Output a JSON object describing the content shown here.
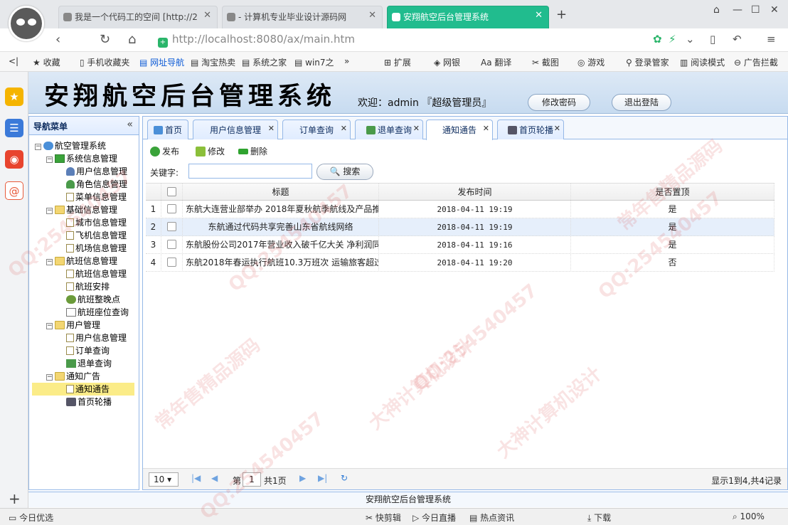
{
  "browser": {
    "tabs": [
      {
        "label": "我是一个代码工的空间 [http://2"
      },
      {
        "label": "- 计算机专业毕业设计源码网"
      },
      {
        "label": "安翔航空后台管理系统"
      }
    ],
    "new_tab": "+",
    "url_host": "http://localhost",
    "url_rest": ":8080/ax/main.htm",
    "bookmarks": [
      "收藏",
      "手机收藏夹",
      "网址导航",
      "淘宝热卖",
      "系统之家",
      "win7之",
      "扩展",
      "网银",
      "翻译",
      "截图",
      "游戏",
      "登录管家",
      "阅读模式",
      "广告拦截"
    ],
    "status": [
      "今日优选",
      "快剪辑",
      "今日直播",
      "热点资讯",
      "下载",
      "100%"
    ]
  },
  "app": {
    "title": "安翔航空后台管理系统",
    "welcome": "欢迎：admin 『超级管理员』",
    "change_password": "修改密码",
    "logout": "退出登陆",
    "footer": "安翔航空后台管理系统"
  },
  "nav": {
    "header": "导航菜单",
    "collapse": "«",
    "nodes": [
      {
        "label": "航空管理系统"
      },
      {
        "label": "系统信息管理"
      },
      {
        "label": "用户信息管理"
      },
      {
        "label": "角色信息管理"
      },
      {
        "label": "菜单信息管理"
      },
      {
        "label": "基础信息管理"
      },
      {
        "label": "城市信息管理"
      },
      {
        "label": "飞机信息管理"
      },
      {
        "label": "机场信息管理"
      },
      {
        "label": "航班信息管理"
      },
      {
        "label": "航班信息管理"
      },
      {
        "label": "航班安排"
      },
      {
        "label": "航班整晚点"
      },
      {
        "label": "航班座位查询"
      },
      {
        "label": "用户管理"
      },
      {
        "label": "用户信息管理"
      },
      {
        "label": "订单查询"
      },
      {
        "label": "退单查询"
      },
      {
        "label": "通知广告"
      },
      {
        "label": "通知通告"
      },
      {
        "label": "首页轮播"
      }
    ]
  },
  "page_tabs": [
    {
      "label": "首页"
    },
    {
      "label": "用户信息管理"
    },
    {
      "label": "订单查询"
    },
    {
      "label": "退单查询"
    },
    {
      "label": "通知通告"
    },
    {
      "label": "首页轮播"
    }
  ],
  "toolbar": {
    "publish": "发布",
    "edit": "修改",
    "delete": "删除"
  },
  "search": {
    "label": "关键字:",
    "value": "",
    "button": "搜索"
  },
  "table": {
    "columns": [
      "标题",
      "发布时间",
      "是否置顶"
    ],
    "rows": [
      {
        "no": "1",
        "title": "东航大连营业部举办 2018年夏秋航季航线及产品推",
        "time": "2018-04-11 19:19",
        "top": "是"
      },
      {
        "no": "2",
        "title": "东航通过代码共享完善山东省航线网络",
        "time": "2018-04-11 19:19",
        "top": "是"
      },
      {
        "no": "3",
        "title": "东航股份公司2017年营业收入破千亿大关 净利润同",
        "time": "2018-04-11 19:16",
        "top": "是"
      },
      {
        "no": "4",
        "title": "东航2018年春运执行航班10.3万班次 运输旅客超过",
        "time": "2018-04-11 19:20",
        "top": "否"
      }
    ]
  },
  "pager": {
    "page_size": "10",
    "page_prefix": "第",
    "page": "1",
    "total_pages": "共1页",
    "summary": "显示1到4,共4记录"
  },
  "watermark": [
    "QQ:254540457",
    "大神计算机设计",
    "常年售精品源码"
  ]
}
